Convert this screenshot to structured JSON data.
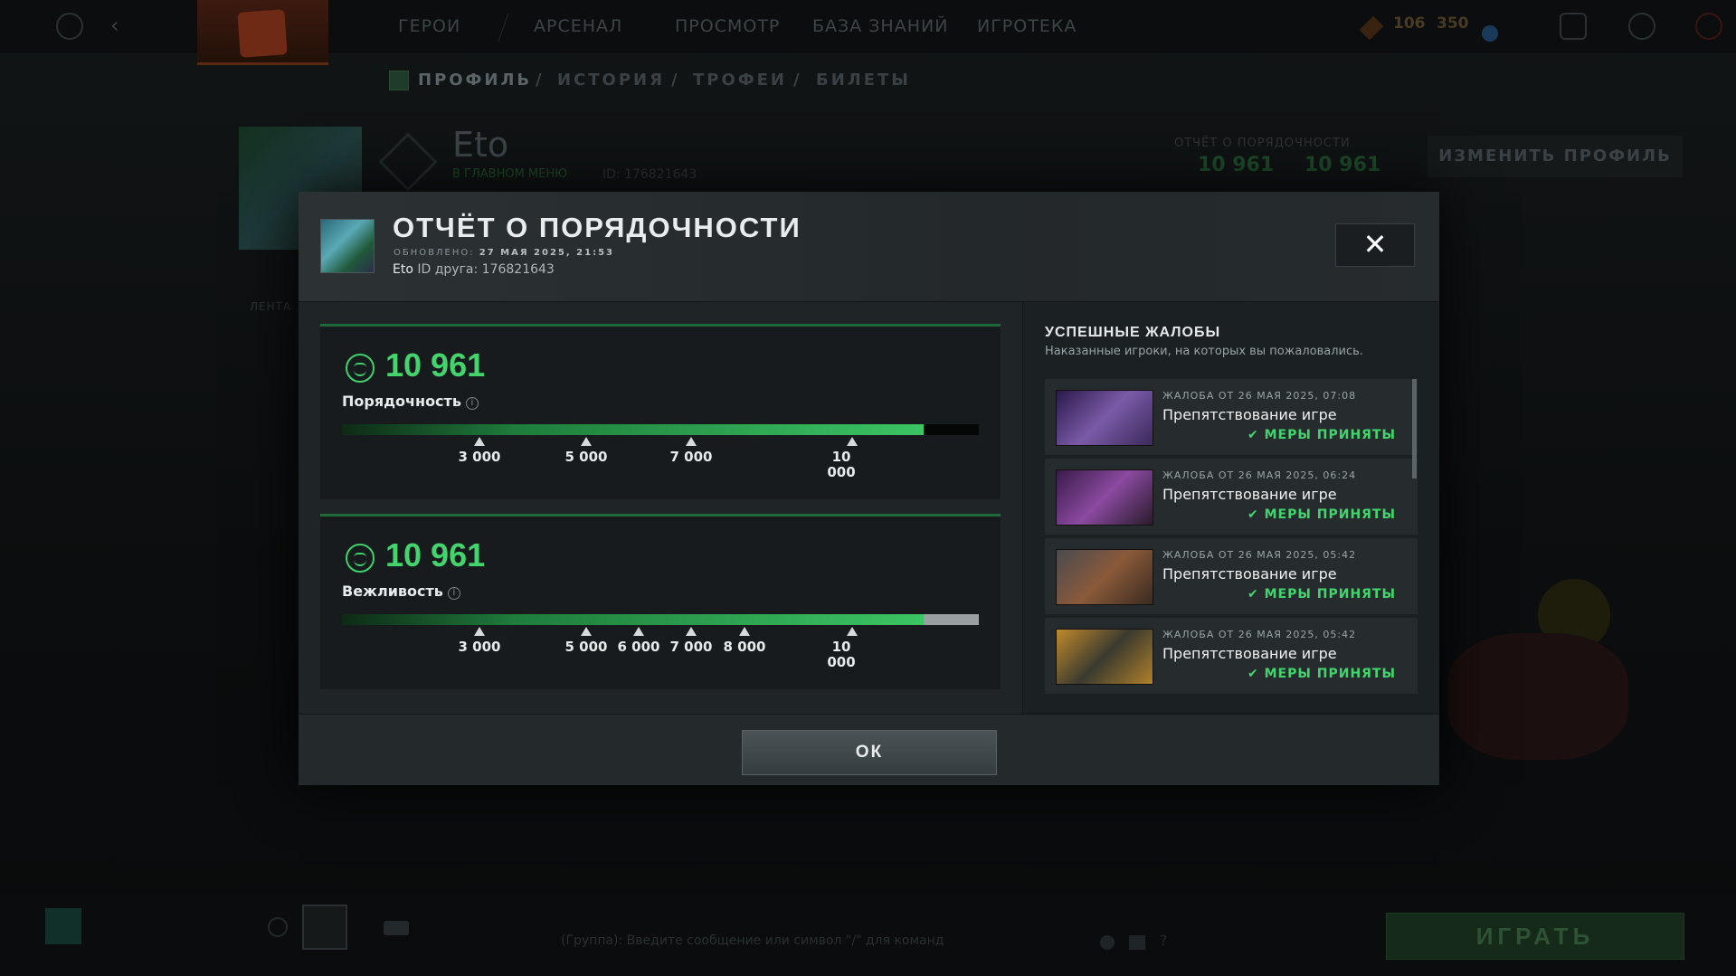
{
  "topnav": {
    "items": [
      "ГЕРОИ",
      "АРСЕНАЛ",
      "ПРОСМОТР",
      "БАЗА ЗНАНИЙ",
      "ИГРОТЕКА"
    ],
    "currency_a": "106",
    "currency_b": "350"
  },
  "subnav": {
    "items": [
      "ПРОФИЛЬ",
      "/",
      "ИСТОРИЯ",
      "/",
      "ТРОФЕИ",
      "/",
      "БИЛЕТЫ"
    ]
  },
  "profile": {
    "name": "Eto",
    "status": "В ГЛАВНОМ МЕНЮ",
    "id_text": "ID: 176821643",
    "conduct_label": "ОТЧЁТ О ПОРЯДОЧНОСТИ",
    "score_a": "10 961",
    "score_b": "10 961",
    "edit_button": "ИЗМЕНИТЬ ПРОФИЛЬ",
    "feed_label": "ЛЕНТА"
  },
  "modal": {
    "title": "ОТЧЁТ О ПОРЯДОЧНОСТИ",
    "updated_label": "ОБНОВЛЕНО:",
    "updated_value": "27 МАЯ 2025, 21:53",
    "player_name": "Eto",
    "friend_id": "ID друга: 176821643",
    "close_glyph": "✕",
    "ok_label": "ОК"
  },
  "behavior": {
    "value": "10 961",
    "label": "Порядочность",
    "fill_fraction": 0.913,
    "ticks": [
      "3 000",
      "5 000",
      "7 000",
      "10 000"
    ]
  },
  "communication": {
    "value": "10 961",
    "label": "Вежливость",
    "fill_fraction": 0.913,
    "ticks": [
      "3 000",
      "5 000",
      "6 000",
      "7 000",
      "8 000",
      "10 000"
    ]
  },
  "reports": {
    "title": "УСПЕШНЫЕ ЖАЛОБЫ",
    "subtitle": "Наказанные игроки, на которых вы пожаловались.",
    "items": [
      {
        "date": "ЖАЛОБА ОТ 26 МАЯ 2025, 07:08",
        "reason": "Препятствование игре",
        "status": "МЕРЫ ПРИНЯТЫ",
        "hero_color": "#5a3a8a"
      },
      {
        "date": "ЖАЛОБА ОТ 26 МАЯ 2025, 06:24",
        "reason": "Препятствование игре",
        "status": "МЕРЫ ПРИНЯТЫ",
        "hero_color": "#6a3a7a"
      },
      {
        "date": "ЖАЛОБА ОТ 26 МАЯ 2025, 05:42",
        "reason": "Препятствование игре",
        "status": "МЕРЫ ПРИНЯТЫ",
        "hero_color": "#6a4a3a"
      },
      {
        "date": "ЖАЛОБА ОТ 26 МАЯ 2025, 05:42",
        "reason": "Препятствование игре",
        "status": "МЕРЫ ПРИНЯТЫ",
        "hero_color": "#8a6a2a"
      }
    ]
  },
  "bottom": {
    "chat_hint": "(Группа): Введите сообщение или символ \"/\" для команд",
    "play_button": "ИГРАТЬ"
  },
  "colors": {
    "accent_green": "#43d46d",
    "modal_bg": "#1e2325"
  }
}
